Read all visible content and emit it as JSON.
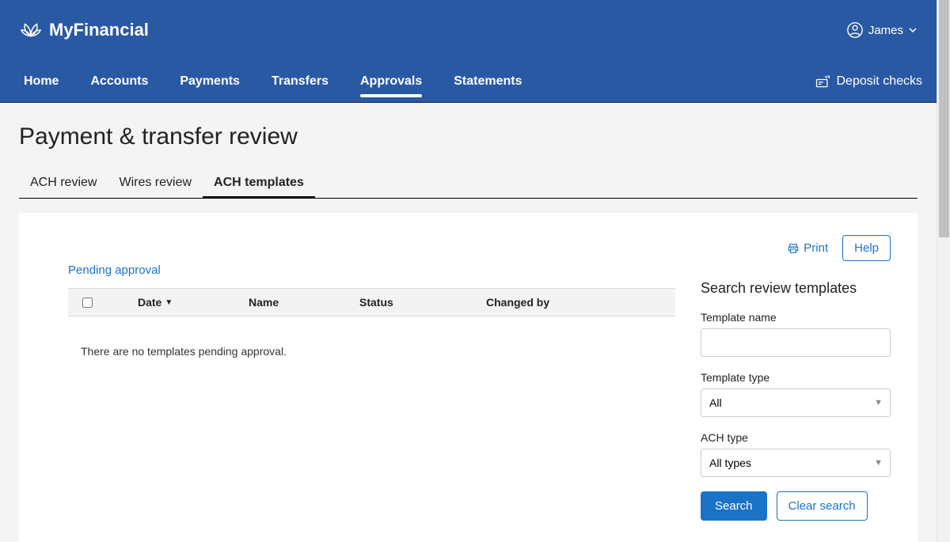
{
  "brand": "MyFinancial",
  "user": {
    "name": "James"
  },
  "nav": {
    "items": [
      "Home",
      "Accounts",
      "Payments",
      "Transfers",
      "Approvals",
      "Statements"
    ],
    "active_index": 4,
    "deposit_label": "Deposit checks"
  },
  "page_title": "Payment & transfer review",
  "tabs": {
    "items": [
      "ACH review",
      "Wires review",
      "ACH templates"
    ],
    "active_index": 2
  },
  "toolbar": {
    "print_label": "Print",
    "help_label": "Help"
  },
  "left": {
    "pending_label": "Pending approval",
    "columns": {
      "date": "Date",
      "name": "Name",
      "status": "Status",
      "changed_by": "Changed by"
    },
    "empty_message": "There are no templates pending approval."
  },
  "search": {
    "title": "Search review templates",
    "template_name_label": "Template name",
    "template_name_value": "",
    "template_type_label": "Template type",
    "template_type_value": "All",
    "ach_type_label": "ACH type",
    "ach_type_value": "All types",
    "search_btn": "Search",
    "clear_btn": "Clear search"
  }
}
